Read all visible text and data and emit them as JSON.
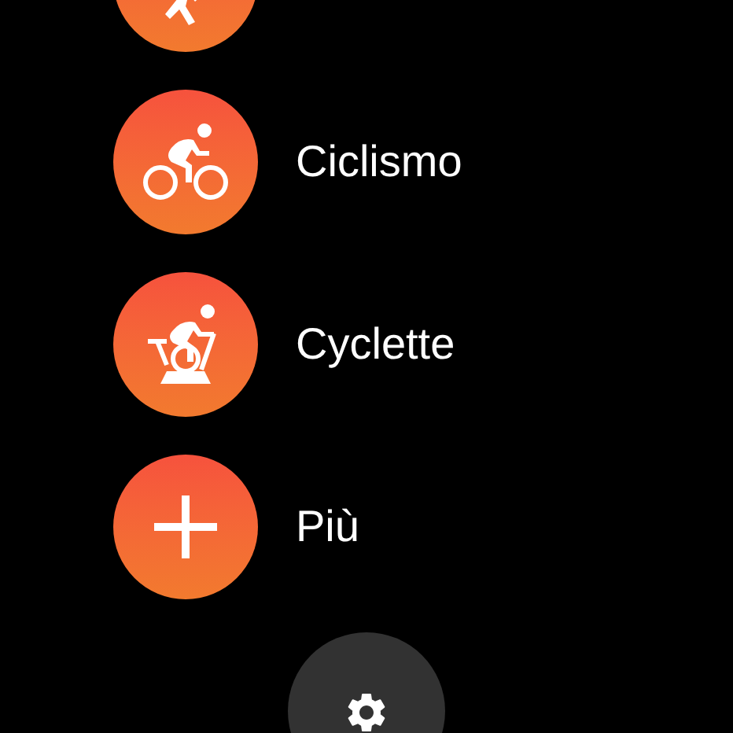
{
  "activities": [
    {
      "kind": "run"
    },
    {
      "kind": "bike",
      "label": "Ciclismo"
    },
    {
      "kind": "stationary_bike",
      "label": "Cyclette"
    },
    {
      "kind": "plus",
      "label": "Più"
    }
  ],
  "settings": {
    "kind": "gear"
  }
}
